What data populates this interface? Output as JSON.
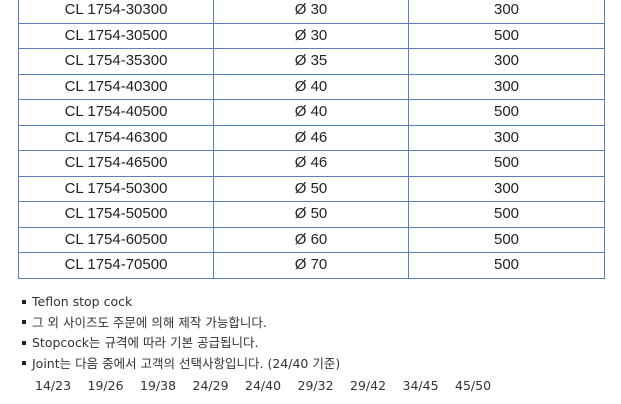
{
  "table": {
    "rows": [
      {
        "code": "CL 1754-30300",
        "diameter": "Ø 30",
        "volume": "300"
      },
      {
        "code": "CL 1754-30500",
        "diameter": "Ø 30",
        "volume": "500"
      },
      {
        "code": "CL 1754-35300",
        "diameter": "Ø 35",
        "volume": "300"
      },
      {
        "code": "CL 1754-40300",
        "diameter": "Ø 40",
        "volume": "300"
      },
      {
        "code": "CL 1754-40500",
        "diameter": "Ø 40",
        "volume": "500"
      },
      {
        "code": "CL 1754-46300",
        "diameter": "Ø 46",
        "volume": "300"
      },
      {
        "code": "CL 1754-46500",
        "diameter": "Ø 46",
        "volume": "500"
      },
      {
        "code": "CL 1754-50300",
        "diameter": "Ø 50",
        "volume": "300"
      },
      {
        "code": "CL 1754-50500",
        "diameter": "Ø 50",
        "volume": "500"
      },
      {
        "code": "CL 1754-60500",
        "diameter": "Ø 60",
        "volume": "500"
      },
      {
        "code": "CL 1754-70500",
        "diameter": "Ø 70",
        "volume": "500"
      }
    ]
  },
  "notes": {
    "items": [
      "Teflon stop cock",
      "그 외 사이즈도 주문에 의해 제작 가능합니다.",
      "Stopcock는 규격에 따라 기본 공급됩니다.",
      "Joint는 다음 중에서 고객의 선택사항입니다. (24/40 기준)"
    ],
    "joints": [
      "14/23",
      "19/26",
      "19/38",
      "24/29",
      "24/40",
      "29/32",
      "29/42",
      "34/45",
      "45/50"
    ]
  },
  "colors": {
    "table_border": "#5b7fb8",
    "text": "#222222"
  }
}
